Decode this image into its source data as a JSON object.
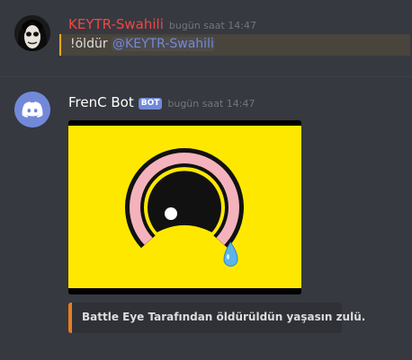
{
  "messages": [
    {
      "author": "KEYTR-Swahili",
      "author_color": "#f04747",
      "avatar_icon": "skull-face-avatar",
      "timestamp": "bugün saat 14:47",
      "text_prefix": "!öldür ",
      "mention": "@KEYTR-Swahili",
      "mention_highlight_color": "#faa61a"
    },
    {
      "author": "FrenC Bot",
      "author_color": "#ffffff",
      "bot_tag": "BOT",
      "avatar_icon": "discord-logo-avatar",
      "timestamp": "bugün saat 14:47",
      "image": {
        "description_icon": "crying-eye-icon",
        "background_color": "#ffe800"
      },
      "embed": {
        "description": "Battle Eye Tarafından öldürüldün yaşasın zulü.",
        "accent_color": "#e67e22"
      }
    }
  ]
}
